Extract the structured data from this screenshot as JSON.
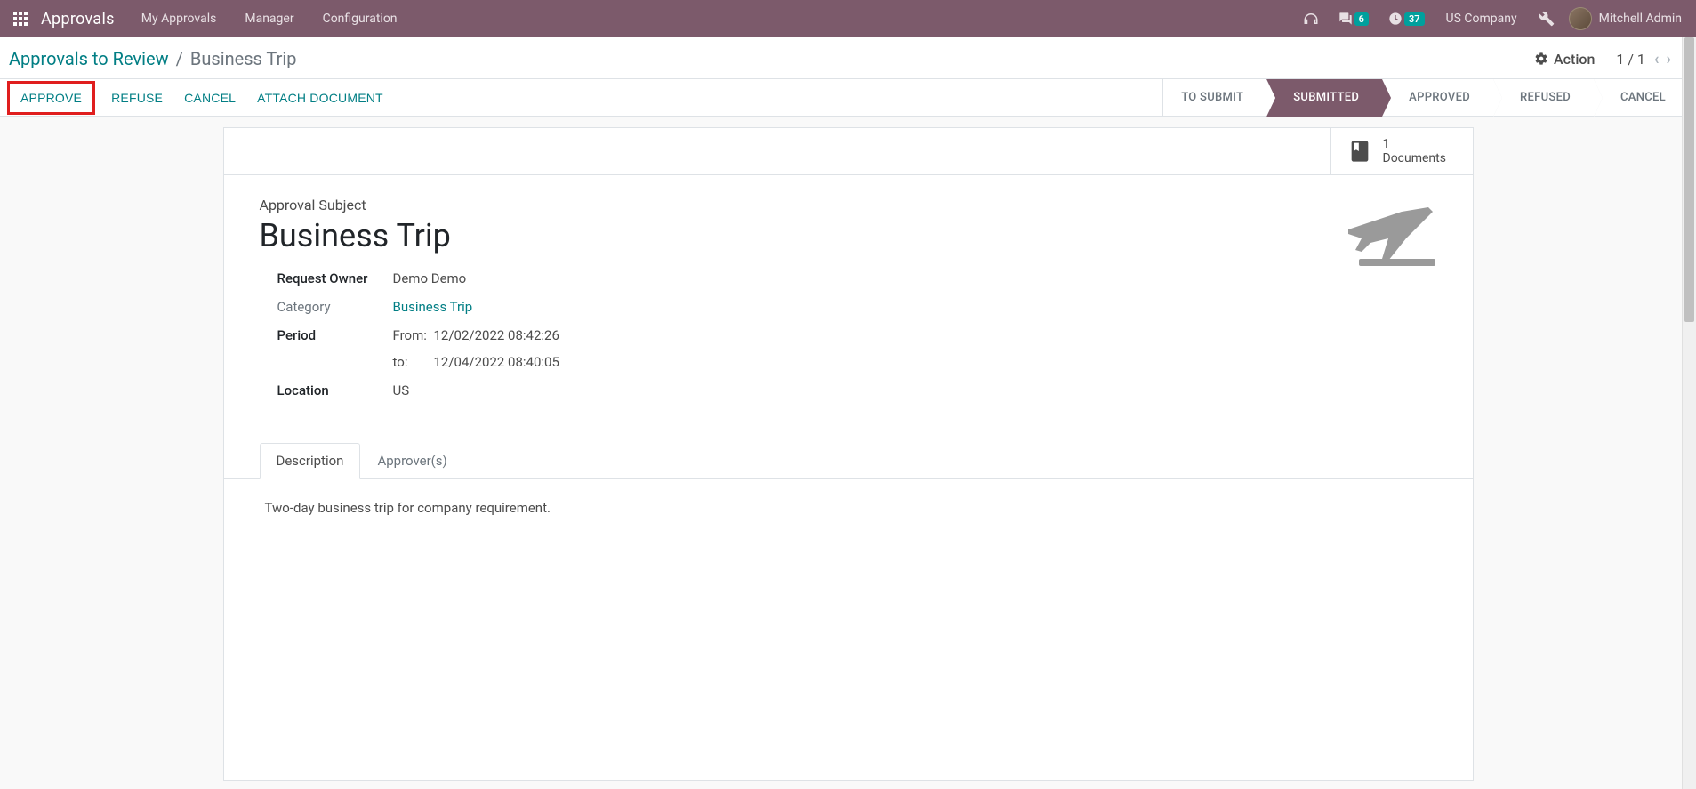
{
  "nav": {
    "app_title": "Approvals",
    "menu": [
      "My Approvals",
      "Manager",
      "Configuration"
    ],
    "chat_count": "6",
    "activity_count": "37",
    "company": "US Company",
    "user_name": "Mitchell Admin"
  },
  "control": {
    "breadcrumb_link": "Approvals to Review",
    "breadcrumb_sep": "/",
    "breadcrumb_current": "Business Trip",
    "action_label": "Action",
    "pager_text": "1 / 1"
  },
  "action_bar": {
    "approve": "APPROVE",
    "refuse": "REFUSE",
    "cancel": "CANCEL",
    "attach": "ATTACH DOCUMENT"
  },
  "statuses": [
    "TO SUBMIT",
    "SUBMITTED",
    "APPROVED",
    "REFUSED",
    "CANCEL"
  ],
  "stat": {
    "count": "1",
    "label": "Documents"
  },
  "form": {
    "subject_label": "Approval Subject",
    "subject_value": "Business Trip",
    "owner_label": "Request Owner",
    "owner_value": "Demo Demo",
    "category_label": "Category",
    "category_value": "Business Trip",
    "period_label": "Period",
    "period_from_prefix": "From:",
    "period_from_value": "12/02/2022 08:42:26",
    "period_to_prefix": "to:",
    "period_to_value": "12/04/2022 08:40:05",
    "location_label": "Location",
    "location_value": "US"
  },
  "tabs": {
    "description": "Description",
    "approvers": "Approver(s)"
  },
  "description_text": "Two-day business trip for company requirement."
}
